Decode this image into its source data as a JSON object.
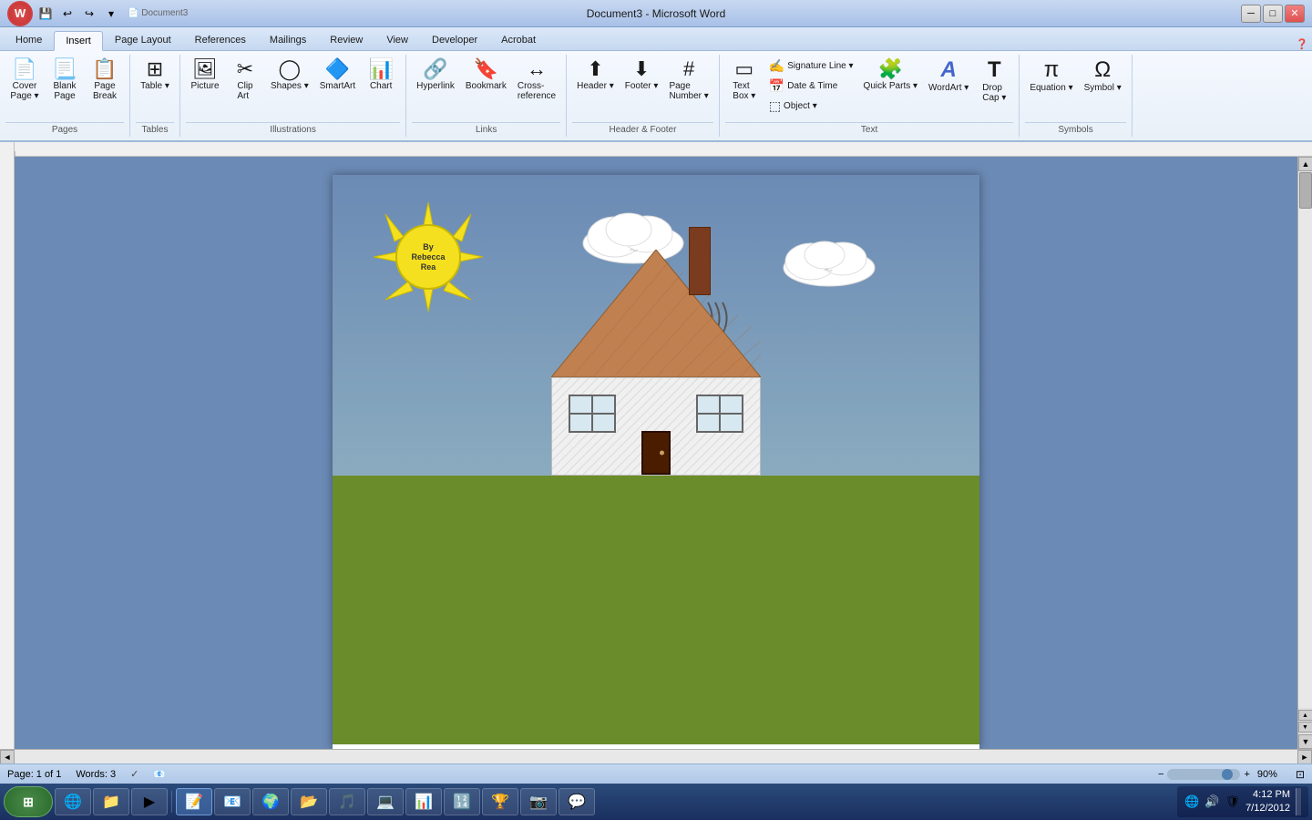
{
  "titlebar": {
    "title": "Document3 - Microsoft Word",
    "quick_access": [
      "save",
      "undo",
      "redo",
      "customize"
    ]
  },
  "ribbon": {
    "tabs": [
      "Home",
      "Insert",
      "Page Layout",
      "References",
      "Mailings",
      "Review",
      "View",
      "Developer",
      "Acrobat"
    ],
    "active_tab": "Insert",
    "groups": {
      "pages": {
        "label": "Pages",
        "buttons": [
          {
            "id": "cover-page",
            "label": "Cover\nPage",
            "icon": "📄"
          },
          {
            "id": "blank-page",
            "label": "Blank\nPage",
            "icon": "📃"
          },
          {
            "id": "page-break",
            "label": "Page\nBreak",
            "icon": "📋"
          }
        ]
      },
      "tables": {
        "label": "Tables",
        "buttons": [
          {
            "id": "table",
            "label": "Table",
            "icon": "⊞"
          }
        ]
      },
      "illustrations": {
        "label": "Illustrations",
        "buttons": [
          {
            "id": "picture",
            "label": "Picture",
            "icon": "🖼"
          },
          {
            "id": "clip-art",
            "label": "Clip\nArt",
            "icon": "✂"
          },
          {
            "id": "shapes",
            "label": "Shapes",
            "icon": "◯"
          },
          {
            "id": "smartart",
            "label": "SmartArt",
            "icon": "🔷"
          },
          {
            "id": "chart",
            "label": "Chart",
            "icon": "📊"
          }
        ]
      },
      "links": {
        "label": "Links",
        "buttons": [
          {
            "id": "hyperlink",
            "label": "Hyperlink",
            "icon": "🔗"
          },
          {
            "id": "bookmark",
            "label": "Bookmark",
            "icon": "🔖"
          },
          {
            "id": "cross-ref",
            "label": "Cross-reference",
            "icon": "↔"
          }
        ]
      },
      "header_footer": {
        "label": "Header & Footer",
        "buttons": [
          {
            "id": "header",
            "label": "Header",
            "icon": "⬆"
          },
          {
            "id": "footer",
            "label": "Footer",
            "icon": "⬇"
          },
          {
            "id": "page-number",
            "label": "Page\nNumber",
            "icon": "#"
          }
        ]
      },
      "text": {
        "label": "Text",
        "buttons": [
          {
            "id": "text-box",
            "label": "Text\nBox",
            "icon": "▭"
          },
          {
            "id": "quick-parts",
            "label": "Quick Parts",
            "icon": "🧩"
          },
          {
            "id": "wordart",
            "label": "WordArt",
            "icon": "A"
          },
          {
            "id": "drop-cap",
            "label": "Drop\nCap",
            "icon": "T"
          }
        ],
        "small_buttons": [
          {
            "id": "signature-line",
            "label": "Signature Line"
          },
          {
            "id": "date-time",
            "label": "Date & Time"
          },
          {
            "id": "object",
            "label": "Object"
          }
        ]
      },
      "symbols": {
        "label": "Symbols",
        "buttons": [
          {
            "id": "equation",
            "label": "Equation",
            "icon": "π"
          },
          {
            "id": "symbol",
            "label": "Symbol",
            "icon": "Ω"
          }
        ]
      }
    }
  },
  "document": {
    "page_number": "Page: 1 of 1",
    "words": "Words: 3",
    "zoom": "90%",
    "scene": {
      "sun_text": "By\nRebecca\nRea",
      "sky_color": "#7a9ab8",
      "ground_color": "#6b8c2a"
    }
  },
  "statusbar": {
    "page": "Page: 1 of 1",
    "words": "Words: 3",
    "zoom_level": "90%",
    "zoom_minus": "−",
    "zoom_plus": "+"
  },
  "taskbar": {
    "time": "4:12 PM",
    "date": "7/12/2012",
    "start_icon": "⊞",
    "apps": [
      "📧",
      "🌐",
      "📁",
      "📝",
      "▶",
      "🌍",
      "📬",
      "🎵",
      "💻",
      "📊",
      "🔢",
      "🎯",
      "📷"
    ],
    "notification_icons": [
      "🔊",
      "🌐",
      "🛡"
    ]
  }
}
